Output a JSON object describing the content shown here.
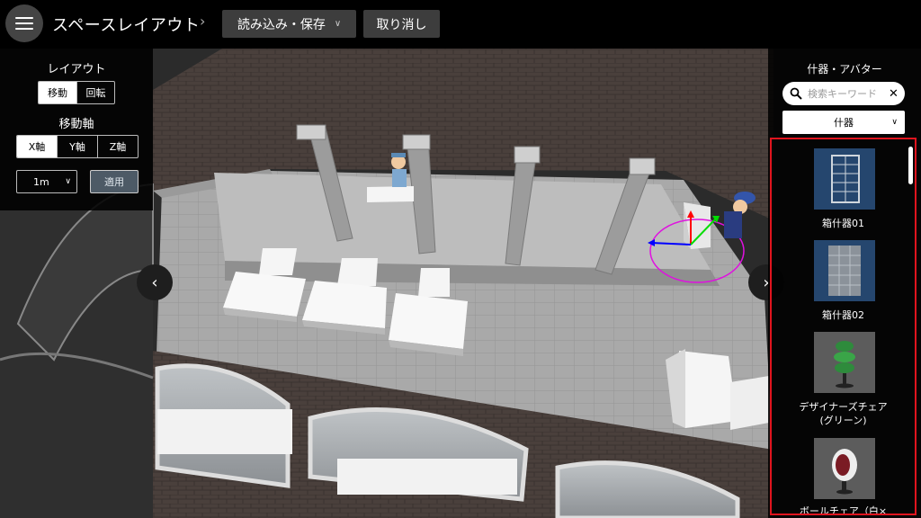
{
  "header": {
    "title": "スペースレイアウト",
    "load_save_label": "読み込み・保存",
    "undo_label": "取り消し"
  },
  "left_panel": {
    "layout_label": "レイアウト",
    "mode_options": [
      "移動",
      "回転"
    ],
    "mode_selected": "移動",
    "axis_label": "移動軸",
    "axis_options": [
      "X軸",
      "Y軸",
      "Z軸"
    ],
    "axis_selected": "X軸",
    "step_value": "1m",
    "apply_label": "適用"
  },
  "right_panel": {
    "title": "什器・アバター",
    "search": {
      "placeholder": "検索キーワード",
      "value": ""
    },
    "category_value": "什器",
    "items": [
      {
        "label": "箱什器01",
        "icon": "shelf-grid-icon"
      },
      {
        "label": "箱什器02",
        "icon": "shelf-box-icon"
      },
      {
        "label": "デザイナーズチェア\n(グリーン)",
        "icon": "green-chair-icon"
      },
      {
        "label": "ボールチェア（白×",
        "icon": "ball-chair-icon"
      }
    ]
  },
  "colors": {
    "topbar_bg": "#000000",
    "panel_bg": "#0e0e0e",
    "catalog_border": "#e0141e",
    "gizmo_x": "#ff0000",
    "gizmo_y": "#00dd00",
    "gizmo_z": "#0000ff",
    "gizmo_ring": "#e010e0"
  }
}
